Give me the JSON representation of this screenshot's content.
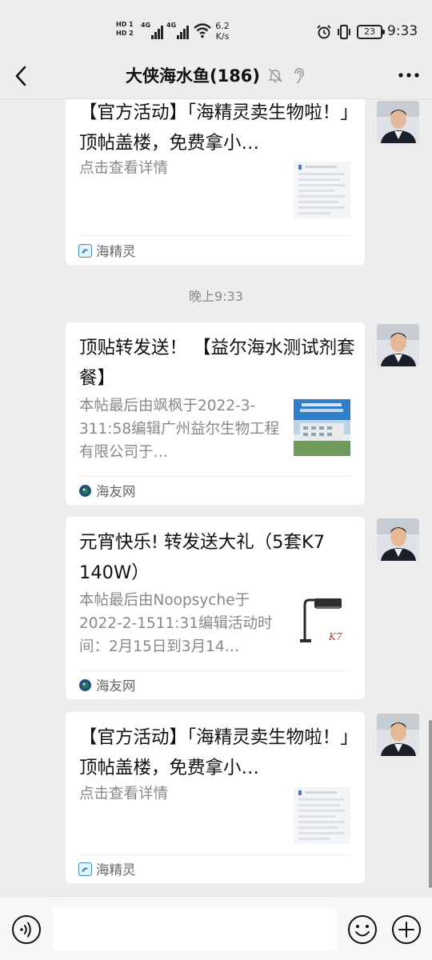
{
  "status_bar": {
    "hd_top": "HD",
    "hd_top_index": "1",
    "hd_bottom": "HD",
    "hd_bottom_index": "2",
    "sim1_label": "4G",
    "sim2_label": "4G",
    "net_speed_value": "6.2",
    "net_speed_unit": "K/s",
    "battery": "23",
    "time": "9:33"
  },
  "header": {
    "title": "大侠海水鱼(186)",
    "icons": [
      "back-icon",
      "mute-icon",
      "ear-icon",
      "more-icon"
    ]
  },
  "messages": [
    {
      "type": "link_card",
      "title": "【官方活动】「海精灵卖生物啦！」顶帖盖楼，免费拿小…",
      "desc": "点击查看详情",
      "source": "海精灵",
      "source_icon": "haijingling-icon",
      "thumbnail": "blurred-document-thumbnail"
    },
    {
      "type": "timestamp",
      "text": "晚上9:33"
    },
    {
      "type": "link_card",
      "title": "顶贴转发送！ 【益尔海水测试剂套餐】",
      "desc": "本帖最后由飒枫于2022-3-311:58编辑广州益尔生物工程有限公司于…",
      "source": "海友网",
      "source_icon": "haiyouwang-icon",
      "thumbnail": "company-building-thumbnail"
    },
    {
      "type": "link_card",
      "title": "元宵快乐! 转发送大礼（5套K7 140W）",
      "desc": "本帖最后由Noopsyche于2022-2-1511:31编辑活动时间：2月15日到3月14…",
      "source": "海友网",
      "source_icon": "haiyouwang-icon",
      "thumbnail": "aquarium-lamp-thumbnail",
      "thumbnail_text": "K7"
    },
    {
      "type": "link_card",
      "title": "【官方活动】「海精灵卖生物啦！」顶帖盖楼，免费拿小…",
      "desc": "点击查看详情",
      "source": "海精灵",
      "source_icon": "haijingling-icon",
      "thumbnail": "blurred-document-thumbnail"
    }
  ],
  "input_bar": {
    "icons": [
      "voice-icon",
      "emoji-icon",
      "plus-icon"
    ],
    "value": ""
  },
  "colors": {
    "background": "#ededed",
    "card": "#ffffff",
    "source_blue": "#3c8dbc",
    "haiyou_green": "#2a7a5a"
  }
}
